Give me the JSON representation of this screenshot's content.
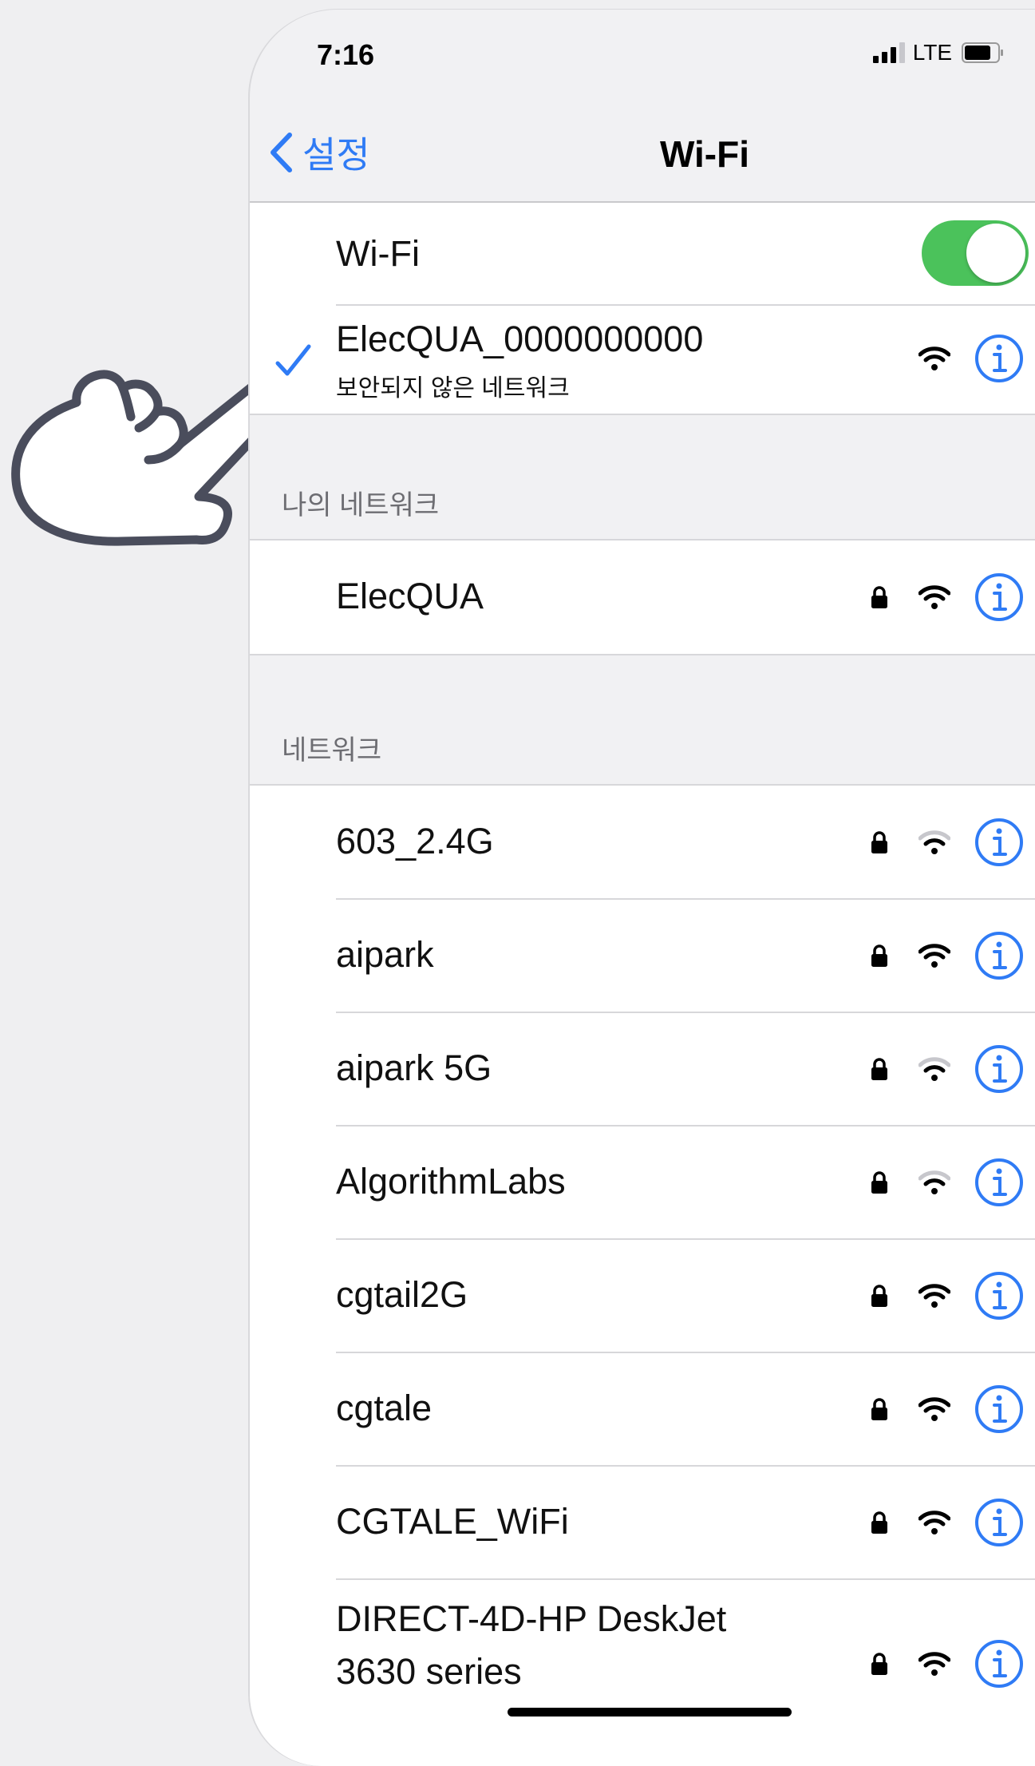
{
  "status_bar": {
    "time": "7:16",
    "network": "LTE"
  },
  "nav": {
    "back_label": "설정",
    "title": "Wi-Fi"
  },
  "wifi_toggle": {
    "label": "Wi-Fi",
    "on": true
  },
  "connected": {
    "name": "ElecQUA_0000000000",
    "subtitle": "보안되지 않은 네트워크"
  },
  "my_networks": {
    "header": "나의 네트워크",
    "items": [
      {
        "name": "ElecQUA",
        "locked": true,
        "signal": "strong"
      }
    ]
  },
  "networks": {
    "header": "네트워크",
    "items": [
      {
        "name": "603_2.4G",
        "locked": true,
        "signal": "weak"
      },
      {
        "name": "aipark",
        "locked": true,
        "signal": "strong"
      },
      {
        "name": "aipark 5G",
        "locked": true,
        "signal": "weak"
      },
      {
        "name": "AlgorithmLabs",
        "locked": true,
        "signal": "weak"
      },
      {
        "name": "cgtail2G",
        "locked": true,
        "signal": "strong"
      },
      {
        "name": "cgtale",
        "locked": true,
        "signal": "strong"
      },
      {
        "name": "CGTALE_WiFi",
        "locked": true,
        "signal": "strong"
      },
      {
        "name": "DIRECT-4D-HP DeskJet",
        "name_line2": "3630 series",
        "locked": true,
        "signal": "strong"
      }
    ]
  },
  "colors": {
    "accent": "#2f7bf5",
    "toggle_on": "#4bc25b",
    "hand_outline": "#4a4d5c"
  }
}
